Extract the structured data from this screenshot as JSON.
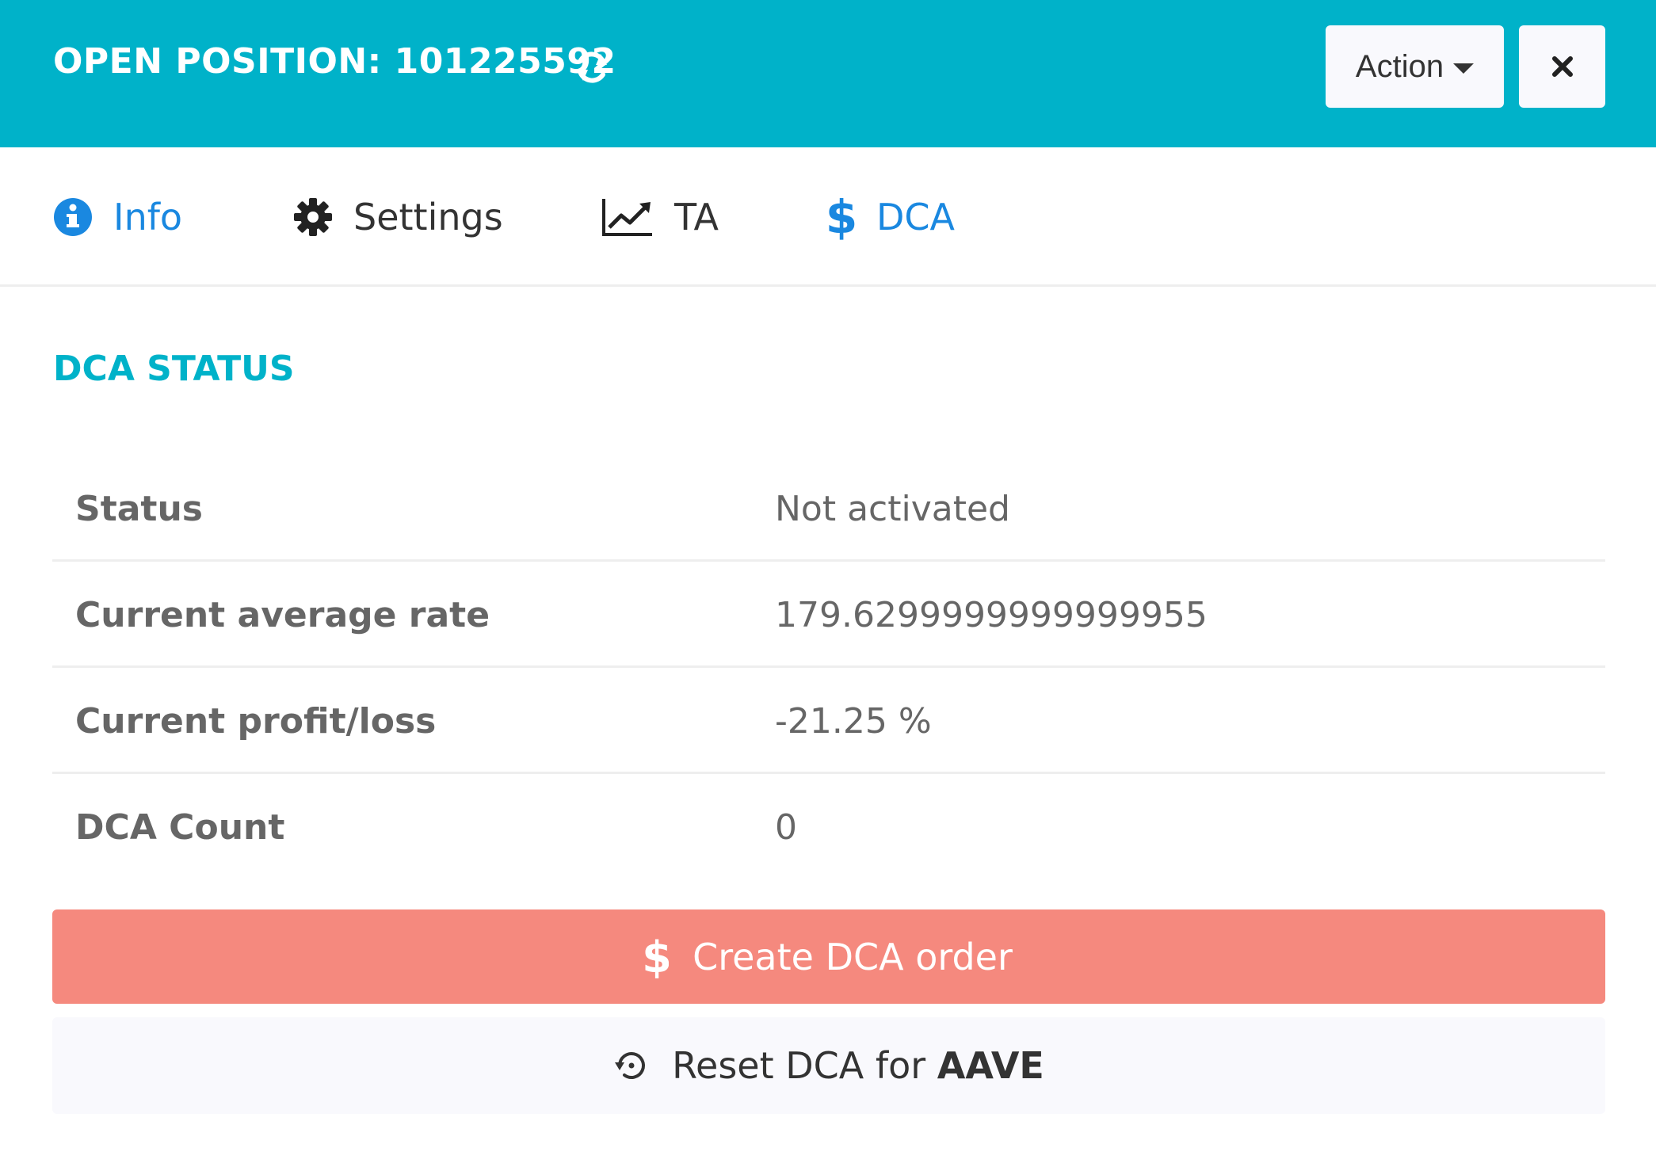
{
  "header": {
    "title": "OPEN POSITION: 101225592",
    "action_label": "Action",
    "background_color": "#00b2c9"
  },
  "tabs": [
    {
      "label": "Info",
      "icon": "info-icon",
      "active": true
    },
    {
      "label": "Settings",
      "icon": "gear-icon",
      "active": false
    },
    {
      "label": "TA",
      "icon": "chart-line-icon",
      "active": false
    },
    {
      "label": "DCA",
      "icon": "dollar-icon",
      "active": true
    }
  ],
  "section": {
    "title": "DCA STATUS"
  },
  "rows": [
    {
      "label": "Status",
      "value": "Not activated"
    },
    {
      "label": "Current average rate",
      "value": "179.6299999999999955"
    },
    {
      "label": "Current profit/loss",
      "value": "-21.25 %"
    },
    {
      "label": "DCA Count",
      "value": "0"
    }
  ],
  "buttons": {
    "create_label": "Create DCA order",
    "create_color": "#f5897e",
    "reset_prefix": "Reset DCA for ",
    "reset_symbol": "AAVE"
  }
}
